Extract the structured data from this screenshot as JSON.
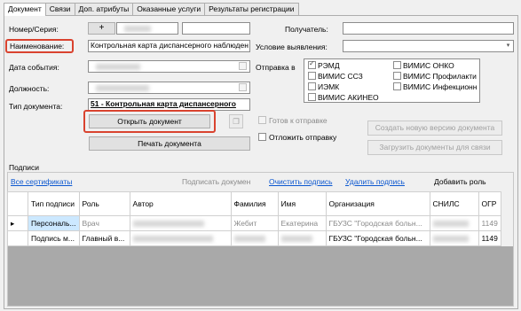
{
  "tabs": [
    "Документ",
    "Связи",
    "Доп. атрибуты",
    "Оказанные услуги",
    "Результаты регистрации"
  ],
  "left": {
    "number_series_label": "Номер/Серия:",
    "plus_label": "+",
    "name_label": "Наименование:",
    "name_value": "Контрольная карта диспансерного наблюден",
    "event_date_label": "Дата события:",
    "position_label": "Должность:",
    "doc_type_label": "Тип документа:",
    "doc_type_value": "51 - Контрольная карта диспансерного",
    "open_doc_button": "Открыть документ",
    "print_doc_button": "Печать документа"
  },
  "right": {
    "recipient_label": "Получатель:",
    "detection_label": "Условие выявления:",
    "send_to_label": "Отправка в",
    "send_targets": [
      {
        "label": "РЭМД",
        "checked": true
      },
      {
        "label": "ВИМИС ОНКО",
        "checked": false
      },
      {
        "label": "ВИМИС ССЗ",
        "checked": false
      },
      {
        "label": "ВИМИС Профилакти",
        "checked": false
      },
      {
        "label": "ИЭМК",
        "checked": false
      },
      {
        "label": "ВИМИС Инфекционн",
        "checked": false
      },
      {
        "label": "ВИМИС АКИНЕО",
        "checked": false
      }
    ],
    "ready_label": "Готов к отправке",
    "postpone_label": "Отложить отправку",
    "new_version_button": "Создать новую версию документа",
    "load_docs_button": "Загрузить документы для связи"
  },
  "signatures": {
    "section_label": "Подписи",
    "all_certs_link": "Все сертификаты",
    "sign_doc_action": "Подписать докумен",
    "clear_sig_link": "Очистить подпись",
    "delete_sig_link": "Удалить подпись",
    "add_role_action": "Добавить роль",
    "columns": [
      "Тип подписи",
      "Роль",
      "Автор",
      "Фамилия",
      "Имя",
      "Организация",
      "СНИЛС",
      "ОГР"
    ],
    "rows": [
      {
        "type": "Персональ...",
        "role": "Врач",
        "author": "",
        "last": "Жебит",
        "first": "Екатерина",
        "org": "ГБУЗС \"Городская больн...",
        "snils": "",
        "ogr": "1149"
      },
      {
        "type": "Подпись м...",
        "role": "Главный в...",
        "author": "",
        "last": "",
        "first": "",
        "org": "ГБУЗС \"Городская больн...",
        "snils": "",
        "ogr": "1149"
      }
    ]
  }
}
